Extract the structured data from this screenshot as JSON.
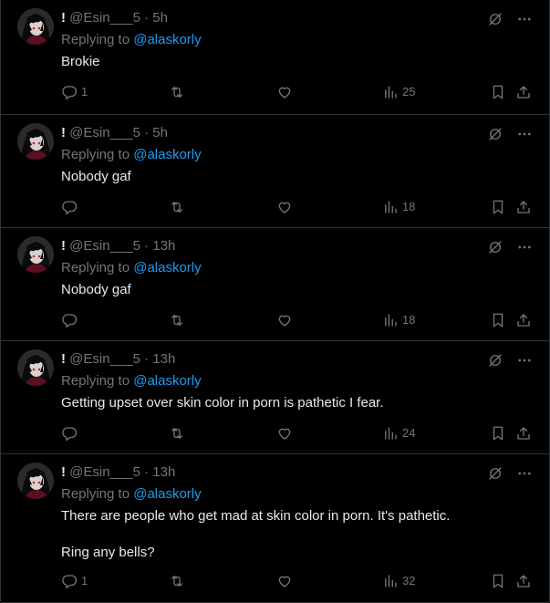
{
  "icons": {
    "reply": "reply-icon",
    "retweet": "retweet-icon",
    "like": "heart-icon",
    "views": "views-icon",
    "bookmark": "bookmark-icon",
    "share": "share-icon",
    "grok": "grok-icon",
    "more": "more-icon"
  },
  "colors": {
    "background": "#000000",
    "divider": "#2f3336",
    "muted": "#71767b",
    "text": "#e7e9ea",
    "link": "#1d9bf0"
  },
  "tweets": [
    {
      "name": "!",
      "handle": "@Esin___5",
      "sep": "·",
      "time": "5h",
      "replying_prefix": "Replying to",
      "mention": "@alaskorly",
      "lines": [
        "Brokie"
      ],
      "replies": "1",
      "views": "25"
    },
    {
      "name": "!",
      "handle": "@Esin___5",
      "sep": "·",
      "time": "5h",
      "replying_prefix": "Replying to",
      "mention": "@alaskorly",
      "lines": [
        "Nobody gaf"
      ],
      "replies": "",
      "views": "18"
    },
    {
      "name": "!",
      "handle": "@Esin___5",
      "sep": "·",
      "time": "13h",
      "replying_prefix": "Replying to",
      "mention": "@alaskorly",
      "lines": [
        "Nobody gaf"
      ],
      "replies": "",
      "views": "18"
    },
    {
      "name": "!",
      "handle": "@Esin___5",
      "sep": "·",
      "time": "13h",
      "replying_prefix": "Replying to",
      "mention": "@alaskorly",
      "lines": [
        "Getting upset over skin color in porn is pathetic I fear."
      ],
      "replies": "",
      "views": "24"
    },
    {
      "name": "!",
      "handle": "@Esin___5",
      "sep": "·",
      "time": "13h",
      "replying_prefix": "Replying to",
      "mention": "@alaskorly",
      "lines": [
        "There are people who get mad at skin color in porn. It's pathetic.",
        "",
        "Ring any bells?"
      ],
      "replies": "1",
      "views": "32"
    }
  ]
}
